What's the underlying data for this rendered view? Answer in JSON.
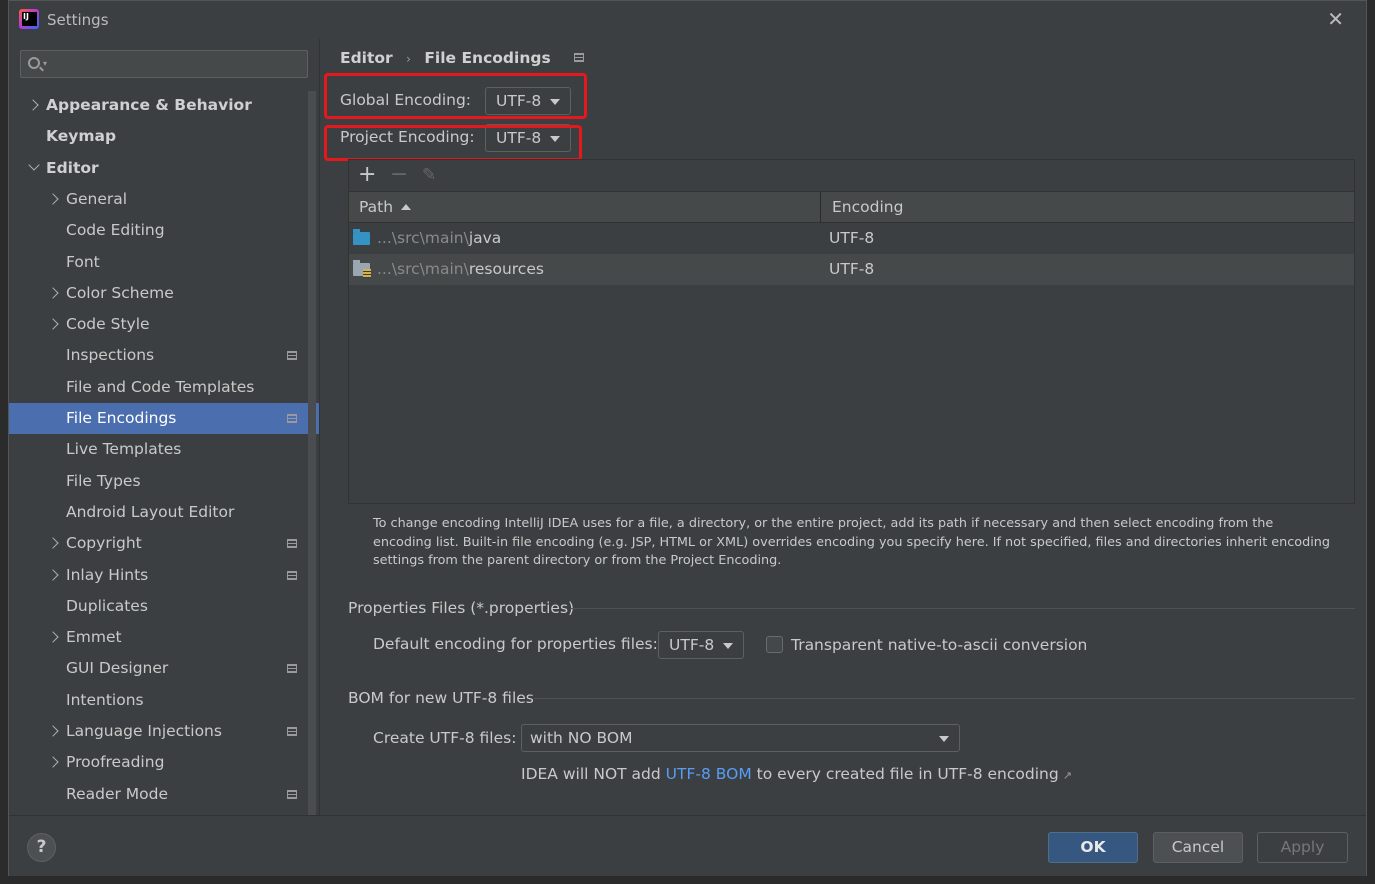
{
  "window": {
    "title": "Settings"
  },
  "sidebar": {
    "items": [
      {
        "label": "Appearance & Behavior",
        "level": 0,
        "arrow": "right",
        "bold": true,
        "selected": false,
        "project_icon": false
      },
      {
        "label": "Keymap",
        "level": 0,
        "arrow": "none",
        "bold": true,
        "selected": false,
        "project_icon": false
      },
      {
        "label": "Editor",
        "level": 0,
        "arrow": "down",
        "bold": true,
        "selected": false,
        "project_icon": false
      },
      {
        "label": "General",
        "level": 1,
        "arrow": "right",
        "bold": false,
        "selected": false,
        "project_icon": false
      },
      {
        "label": "Code Editing",
        "level": 1,
        "arrow": "none",
        "bold": false,
        "selected": false,
        "project_icon": false
      },
      {
        "label": "Font",
        "level": 1,
        "arrow": "none",
        "bold": false,
        "selected": false,
        "project_icon": false
      },
      {
        "label": "Color Scheme",
        "level": 1,
        "arrow": "right",
        "bold": false,
        "selected": false,
        "project_icon": false
      },
      {
        "label": "Code Style",
        "level": 1,
        "arrow": "right",
        "bold": false,
        "selected": false,
        "project_icon": false
      },
      {
        "label": "Inspections",
        "level": 1,
        "arrow": "none",
        "bold": false,
        "selected": false,
        "project_icon": true
      },
      {
        "label": "File and Code Templates",
        "level": 1,
        "arrow": "none",
        "bold": false,
        "selected": false,
        "project_icon": false
      },
      {
        "label": "File Encodings",
        "level": 1,
        "arrow": "none",
        "bold": false,
        "selected": true,
        "project_icon": true
      },
      {
        "label": "Live Templates",
        "level": 1,
        "arrow": "none",
        "bold": false,
        "selected": false,
        "project_icon": false
      },
      {
        "label": "File Types",
        "level": 1,
        "arrow": "none",
        "bold": false,
        "selected": false,
        "project_icon": false
      },
      {
        "label": "Android Layout Editor",
        "level": 1,
        "arrow": "none",
        "bold": false,
        "selected": false,
        "project_icon": false
      },
      {
        "label": "Copyright",
        "level": 1,
        "arrow": "right",
        "bold": false,
        "selected": false,
        "project_icon": true
      },
      {
        "label": "Inlay Hints",
        "level": 1,
        "arrow": "right",
        "bold": false,
        "selected": false,
        "project_icon": true
      },
      {
        "label": "Duplicates",
        "level": 1,
        "arrow": "none",
        "bold": false,
        "selected": false,
        "project_icon": false
      },
      {
        "label": "Emmet",
        "level": 1,
        "arrow": "right",
        "bold": false,
        "selected": false,
        "project_icon": false
      },
      {
        "label": "GUI Designer",
        "level": 1,
        "arrow": "none",
        "bold": false,
        "selected": false,
        "project_icon": true
      },
      {
        "label": "Intentions",
        "level": 1,
        "arrow": "none",
        "bold": false,
        "selected": false,
        "project_icon": false
      },
      {
        "label": "Language Injections",
        "level": 1,
        "arrow": "right",
        "bold": false,
        "selected": false,
        "project_icon": true
      },
      {
        "label": "Proofreading",
        "level": 1,
        "arrow": "right",
        "bold": false,
        "selected": false,
        "project_icon": false
      },
      {
        "label": "Reader Mode",
        "level": 1,
        "arrow": "none",
        "bold": false,
        "selected": false,
        "project_icon": true
      }
    ]
  },
  "breadcrumb": {
    "parent": "Editor",
    "separator": "›",
    "current": "File Encodings"
  },
  "global_encoding": {
    "label": "Global Encoding:",
    "value": "UTF-8"
  },
  "project_encoding": {
    "label": "Project Encoding:",
    "value": "UTF-8"
  },
  "table": {
    "toolbar": {
      "add": "+",
      "remove": "−",
      "edit": "✎"
    },
    "headers": {
      "path": "Path",
      "encoding": "Encoding"
    },
    "rows": [
      {
        "path_prefix": "...\\src\\main\\",
        "path_name": "java",
        "encoding": "UTF-8",
        "icon": "source-folder-icon"
      },
      {
        "path_prefix": "...\\src\\main\\",
        "path_name": "resources",
        "encoding": "UTF-8",
        "icon": "resources-folder-icon"
      }
    ]
  },
  "help_text": "To change encoding IntelliJ IDEA uses for a file, a directory, or the entire project, add its path if necessary and then select encoding from the encoding list. Built-in file encoding (e.g. JSP, HTML or XML) overrides encoding you specify here. If not specified, files and directories inherit encoding settings from the parent directory or from the Project Encoding.",
  "properties": {
    "section_title": "Properties Files (*.properties)",
    "default_label": "Default encoding for properties files:",
    "default_value": "UTF-8",
    "transparent_label": "Transparent native-to-ascii conversion",
    "transparent_checked": false
  },
  "bom": {
    "section_title": "BOM for new UTF-8 files",
    "create_label": "Create UTF-8 files:",
    "create_value": "with NO BOM",
    "note_prefix": "IDEA will NOT add ",
    "note_link": "UTF-8 BOM",
    "note_suffix": " to every created file in UTF-8 encoding",
    "note_arrow": "↗"
  },
  "footer": {
    "help": "?",
    "ok": "OK",
    "cancel": "Cancel",
    "apply": "Apply"
  },
  "colors": {
    "selection": "#4b6eaf",
    "highlight_box": "#e5191d",
    "link": "#589df6",
    "ok_button": "#365880"
  }
}
